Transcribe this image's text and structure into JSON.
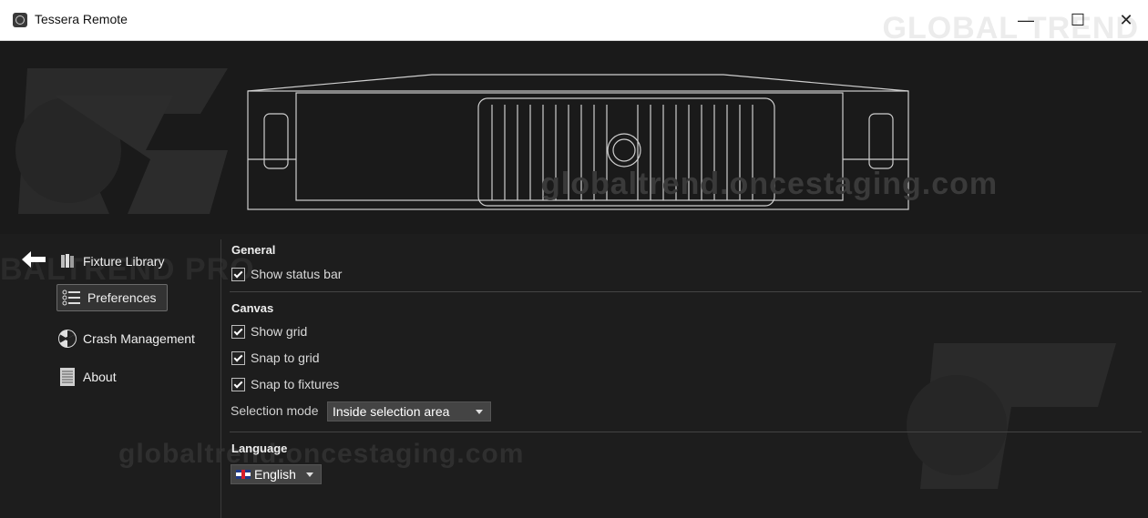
{
  "window": {
    "title": "Tessera Remote",
    "controls": {
      "minimize": "—",
      "maximize": "☐",
      "close": "✕"
    }
  },
  "watermarks": {
    "top_right": "GLOBAL TREND",
    "hero_text": "globaltrend.oncestaging.com",
    "bottom_text": "globaltrend.oncestaging.com",
    "side_text": "BALTREND PRO"
  },
  "sidebar": {
    "items": [
      {
        "label": "Fixture Library",
        "icon": "book-icon"
      },
      {
        "label": "Preferences",
        "icon": "list-icon",
        "selected": true
      },
      {
        "label": "Crash Management",
        "icon": "radiation-icon"
      },
      {
        "label": "About",
        "icon": "document-icon"
      }
    ]
  },
  "preferences": {
    "general": {
      "title": "General",
      "show_status_bar": {
        "label": "Show status bar",
        "checked": true
      }
    },
    "canvas": {
      "title": "Canvas",
      "show_grid": {
        "label": "Show grid",
        "checked": true
      },
      "snap_to_grid": {
        "label": "Snap to grid",
        "checked": true
      },
      "snap_to_fixtures": {
        "label": "Snap to fixtures",
        "checked": true
      },
      "selection_mode": {
        "label": "Selection mode",
        "value": "Inside selection area"
      }
    },
    "language": {
      "title": "Language",
      "value": "English"
    }
  },
  "colors": {
    "background": "#1b1b1b",
    "panel": "#1d1d1d",
    "accent_selected": "#333333"
  }
}
